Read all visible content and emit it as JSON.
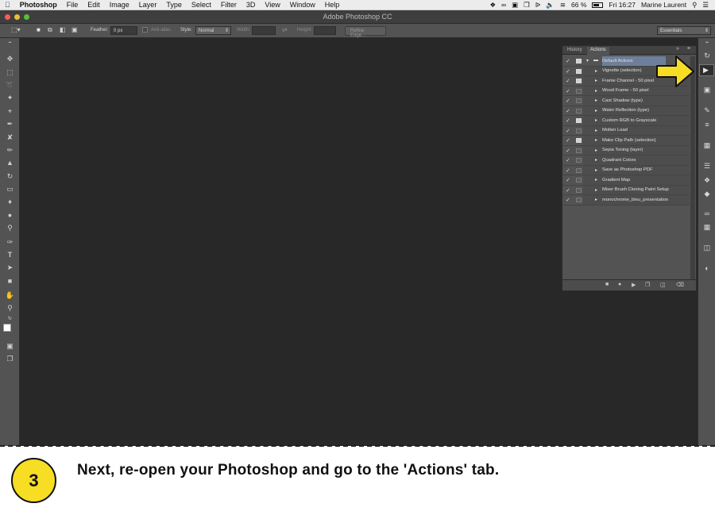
{
  "menubar": {
    "apple": "",
    "items": [
      "Photoshop",
      "File",
      "Edit",
      "Image",
      "Layer",
      "Type",
      "Select",
      "Filter",
      "3D",
      "View",
      "Window",
      "Help"
    ],
    "battery": "66 %",
    "clock": "Fri 16:27",
    "user": "Marine Laurent"
  },
  "window": {
    "title": "Adobe Photoshop CC"
  },
  "options": {
    "feather_label": "Feather:",
    "feather_value": "0 px",
    "antialias_label": "Anti-alias",
    "style_label": "Style:",
    "style_value": "Normal",
    "width_label": "Width:",
    "height_label": "Height:",
    "refine_label": "Refine Edge...",
    "workspace": "Essentials"
  },
  "panel": {
    "tabs": [
      "History",
      "Actions"
    ],
    "actions": [
      {
        "name": "Default Actions",
        "dialog": true,
        "folder": true
      },
      {
        "name": "Vignette (selection)",
        "dialog": true
      },
      {
        "name": "Frame Channel - 50 pixel",
        "dialog": true
      },
      {
        "name": "Wood Frame - 50 pixel",
        "dialog": false
      },
      {
        "name": "Cast Shadow (type)",
        "dialog": false
      },
      {
        "name": "Water Reflection (type)",
        "dialog": false
      },
      {
        "name": "Custom RGB to Grayscale",
        "dialog": true
      },
      {
        "name": "Molten Lead",
        "dialog": false
      },
      {
        "name": "Make Clip Path (selection)",
        "dialog": true
      },
      {
        "name": "Sepia Toning (layer)",
        "dialog": false
      },
      {
        "name": "Quadrant Colors",
        "dialog": false
      },
      {
        "name": "Save as Photoshop PDF",
        "dialog": false
      },
      {
        "name": "Gradient Map",
        "dialog": false
      },
      {
        "name": "Mixer Brush Cloning Paint Setup",
        "dialog": false
      },
      {
        "name": "monochrome_bleu_presentation",
        "dialog": false
      }
    ]
  },
  "colors": {
    "callout_yellow": "#f7de24",
    "canvas": "#282828",
    "panel": "#535353"
  },
  "caption": {
    "step": "3",
    "text": "Next, re-open your Photoshop and go to the 'Actions' tab."
  }
}
